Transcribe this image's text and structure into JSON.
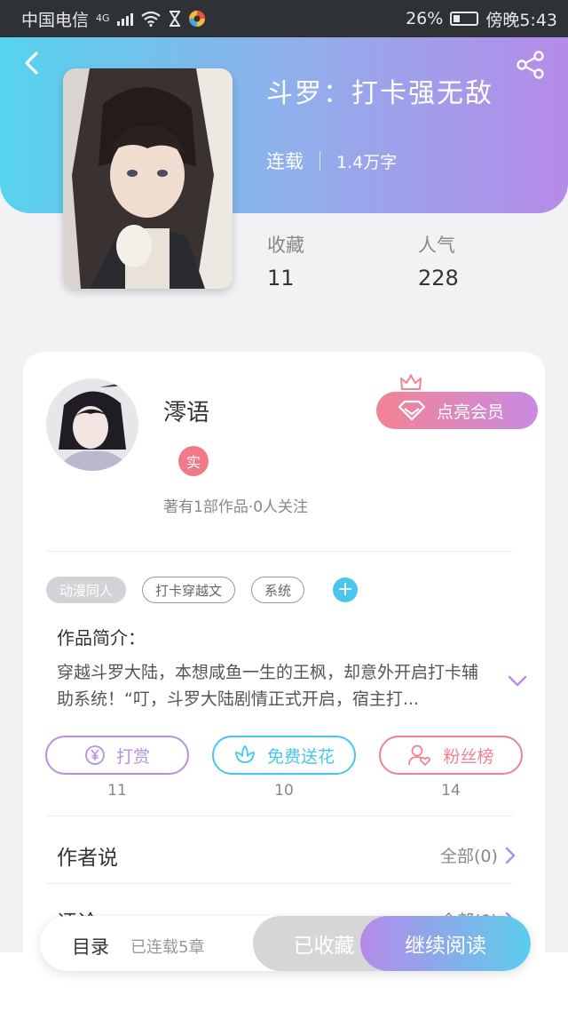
{
  "status_bar": {
    "carrier": "中国电信",
    "network": "4G",
    "battery": "26%",
    "time": "傍晚5:43",
    "icons": [
      "signal-icon",
      "wifi-icon",
      "hourglass-icon",
      "app-notification-icon",
      "battery-icon"
    ]
  },
  "header": {
    "back_icon": "chevron-left-icon",
    "share_icon": "share-icon",
    "cover_image": "anime-character-cover"
  },
  "book": {
    "title": "斗罗：打卡强无敌",
    "status": "连载",
    "word_count": "1.4万字",
    "stats": [
      {
        "label": "收藏",
        "value": "11"
      },
      {
        "label": "人气",
        "value": "228"
      }
    ]
  },
  "author": {
    "name": "澪语",
    "badge": "实",
    "stats": "著有1部作品·0人关注",
    "vip_label": "点亮会员"
  },
  "tags": {
    "items": [
      "动漫同人",
      "打卡穿越文",
      "系统"
    ],
    "add": "+"
  },
  "intro": {
    "heading": "作品简介：",
    "text": "穿越斗罗大陆，本想咸鱼一生的王枫，却意外开启打卡辅助系统！“叮，斗罗大陆剧情正式开启，宿主打..."
  },
  "actions": [
    {
      "label": "打赏",
      "count": "11",
      "icon": "yen-coin-icon",
      "color": "#b591e0"
    },
    {
      "label": "免费送花",
      "count": "10",
      "icon": "flower-icon",
      "color": "#48c6ee"
    },
    {
      "label": "粉丝榜",
      "count": "14",
      "icon": "user-heart-icon",
      "color": "#f08290"
    }
  ],
  "author_says": {
    "title": "作者说",
    "right": "全部(0)"
  },
  "comments": {
    "title": "评论",
    "right": "全部(0)"
  },
  "bottom_bar": {
    "toc_label": "目录",
    "chapter_count": "已连载5章",
    "favorite_label": "已收藏",
    "read_label": "继续阅读"
  },
  "colors": {
    "header_gradient_start": "#56d3ef",
    "header_gradient_end": "#b58be8",
    "accent_blue": "#48c6ee",
    "accent_purple": "#b58be8",
    "accent_pink": "#f08290"
  }
}
